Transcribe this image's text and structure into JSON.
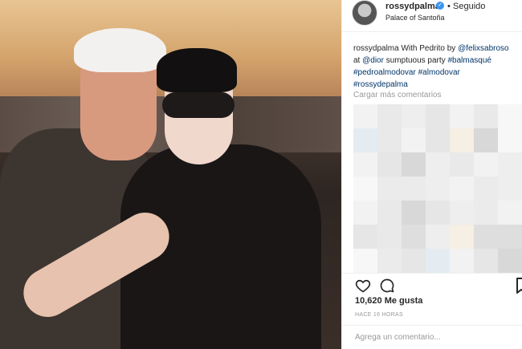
{
  "header": {
    "username": "rossydpalma",
    "verified_mark": "✓",
    "separator": "•",
    "follow_status": "Seguido",
    "location": "Palace of Santoña"
  },
  "caption": {
    "user": "rossydpalma",
    "text_1": "With Pedrito by",
    "mention_1": "@felixsabroso",
    "text_2": "at",
    "mention_2": "@dior",
    "text_3": "sumptuous party",
    "hashtags": [
      "#balmasqué",
      "#pedroalmodovar",
      "#almodovar",
      "#rossydepalma"
    ]
  },
  "load_more": "Cargar más comentarios",
  "likes": "10,620 Me gusta",
  "time": "HACE 16 HORAS",
  "comment": {
    "placeholder": "Agrega un comentario..."
  },
  "icons": {
    "heart": "heart-icon",
    "comment": "comment-icon",
    "bookmark": "bookmark-icon",
    "verified": "verified-badge-icon"
  },
  "colors": {
    "link": "#003569",
    "verified": "#3897f0",
    "muted": "#999999"
  }
}
